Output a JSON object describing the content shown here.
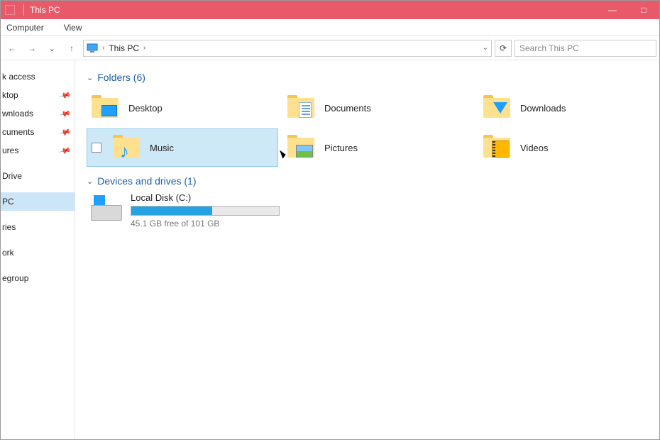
{
  "window": {
    "title": "This PC"
  },
  "ribbon": {
    "tabs": [
      "Computer",
      "View"
    ]
  },
  "address": {
    "crumb": "This PC",
    "chevron": "›",
    "dropdown_glyph": "⌄"
  },
  "toolbar": {
    "search_placeholder": "Search This PC",
    "refresh_glyph": "⟳",
    "back_glyph": "←",
    "forward_glyph": "→",
    "up_glyph": "↑",
    "recent_glyph": "⌄"
  },
  "sidebar": {
    "items": [
      {
        "label": "k access",
        "kind": "header"
      },
      {
        "label": "ktop",
        "pinned": true
      },
      {
        "label": "wnloads",
        "pinned": true
      },
      {
        "label": "cuments",
        "pinned": true
      },
      {
        "label": "ures",
        "pinned": true
      },
      {
        "label": "",
        "gap": true
      },
      {
        "label": "Drive"
      },
      {
        "label": "",
        "gap": true
      },
      {
        "label": "PC",
        "selected": true
      },
      {
        "label": "",
        "gap": true
      },
      {
        "label": "ries"
      },
      {
        "label": "",
        "gap": true
      },
      {
        "label": "ork"
      },
      {
        "label": "",
        "gap": true
      },
      {
        "label": "egroup"
      }
    ]
  },
  "groups": {
    "folders": {
      "title": "Folders (6)",
      "items": [
        {
          "label": "Desktop",
          "icon": "monitor"
        },
        {
          "label": "Documents",
          "icon": "doc"
        },
        {
          "label": "Downloads",
          "icon": "arrow"
        },
        {
          "label": "Music",
          "icon": "note",
          "selected": true
        },
        {
          "label": "Pictures",
          "icon": "pic"
        },
        {
          "label": "Videos",
          "icon": "vid"
        }
      ]
    },
    "drives": {
      "title": "Devices and drives (1)",
      "items": [
        {
          "name": "Local Disk (C:)",
          "free_text": "45.1 GB free of 101 GB",
          "used_pct": 55
        }
      ]
    }
  },
  "window_controls": {
    "min": "—",
    "max": "□"
  }
}
